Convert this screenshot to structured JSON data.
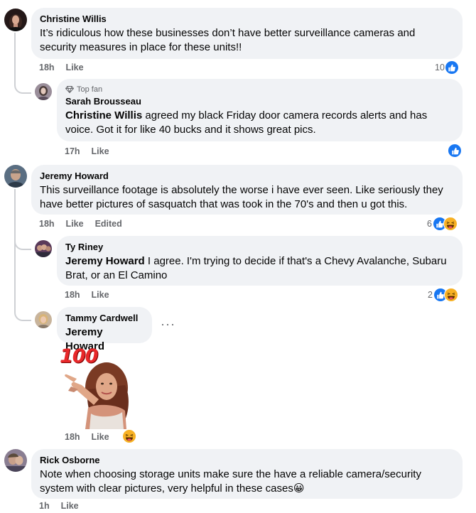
{
  "comments": [
    {
      "author": "Christine Willis",
      "text": "It’s ridiculous how these businesses don’t have better surveillance cameras and security measures in place for these units!!",
      "time": "18h",
      "like_label": "Like",
      "reaction_count": "10",
      "reactions": [
        "like-icon"
      ],
      "avatar_color": "#3a2a2a",
      "replies": [
        {
          "badge": "Top fan",
          "badge_icon": "diamond-icon",
          "author": "Sarah Brousseau",
          "mention": "Christine Willis",
          "text": " agreed my black Friday door camera records alerts and has voice. Got it for like 40 bucks and it shows great pics.",
          "time": "17h",
          "like_label": "Like",
          "reactions": [
            "like-icon"
          ],
          "avatar_color": "#8a7a8a"
        }
      ]
    },
    {
      "author": "Jeremy Howard",
      "text": "This surveillance footage is absolutely the worse i have ever seen. Like seriously they have better pictures of sasquatch that was took in the 70's and then u got this.",
      "time": "18h",
      "like_label": "Like",
      "edited_label": "Edited",
      "reaction_count": "6",
      "reactions": [
        "like-icon",
        "haha-icon"
      ],
      "avatar_color": "#4a5868",
      "replies": [
        {
          "author": "Ty Riney",
          "mention": "Jeremy Howard",
          "text": " I agree. I'm trying to decide if that's a Chevy Avalanche, Subaru Brat, or an El Camino",
          "time": "18h",
          "like_label": "Like",
          "reaction_count": "2",
          "reactions": [
            "like-icon",
            "haha-icon"
          ],
          "avatar_color": "#6a4a5a"
        },
        {
          "author": "Tammy Cardwell",
          "mention": "Jeremy Howard",
          "more_label": "···",
          "sticker_text": "100",
          "sticker_icon": "pointing-woman-sticker",
          "time": "18h",
          "like_label": "Like",
          "reactions": [
            "haha-icon"
          ],
          "avatar_color": "#b89a7a"
        }
      ]
    },
    {
      "author": "Rick Osborne",
      "text": "Note when choosing storage units make sure the have a reliable camera/security system with clear pictures, very helpful in these cases",
      "text_emoji": "😀",
      "time": "1h",
      "like_label": "Like",
      "avatar_color": "#7a6a8a"
    }
  ],
  "colors": {
    "bubble": "#f0f2f5",
    "like_blue": "#1877f2",
    "haha_yellow": "#f7b125",
    "meta_gray": "#65676b",
    "thread_line": "#ced0d4"
  }
}
